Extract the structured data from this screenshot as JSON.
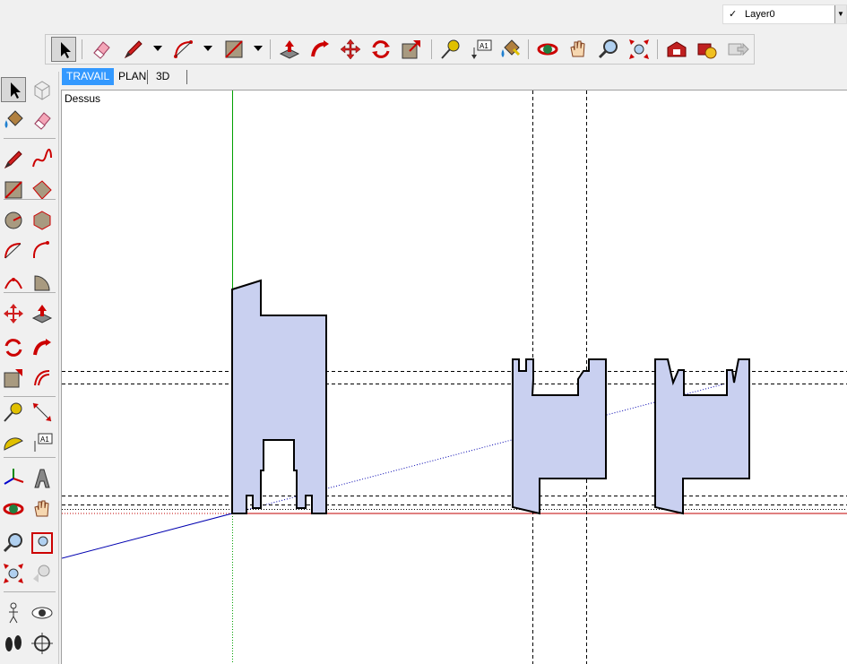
{
  "layer": {
    "check": "✓",
    "name": "Layer0"
  },
  "tabs": [
    {
      "label": "TRAVAIL",
      "active": true
    },
    {
      "label": "PLAN",
      "active": false
    },
    {
      "label": "3D",
      "active": false
    }
  ],
  "viewport": {
    "label": "Dessus"
  },
  "colors": {
    "face": "#c9d0f0",
    "axis_red": "#c00000",
    "axis_green": "#00a000",
    "axis_blue": "#0000b0",
    "tab_active": "#3399ff"
  },
  "toolbar_icons": [
    "select-icon",
    "eraser-icon",
    "pencil-icon",
    "arc-icon",
    "rectangle-icon",
    "push-pull-icon",
    "follow-me-icon",
    "move-icon",
    "rotate-icon",
    "scale-icon",
    "tape-measure-icon",
    "text-icon",
    "paint-bucket-icon",
    "orbit-icon",
    "pan-icon",
    "zoom-icon",
    "zoom-extents-icon",
    "warehouse-icon",
    "extension-icon",
    "share-icon"
  ],
  "left_icons": [
    "select-icon",
    "component-icon",
    "paint-bucket-icon",
    "eraser-icon",
    "pencil-icon",
    "freehand-icon",
    "rectangle-icon",
    "rotated-rectangle-icon",
    "circle-icon",
    "polygon-icon",
    "arc-icon",
    "two-point-arc-icon",
    "three-point-arc-icon",
    "pie-icon",
    "move-icon",
    "push-pull-icon",
    "rotate-icon",
    "follow-me-icon",
    "scale-icon",
    "offset-icon",
    "tape-measure-icon",
    "dimension-icon",
    "protractor-icon",
    "text-icon",
    "axes-icon",
    "3d-text-icon",
    "orbit-icon",
    "pan-icon",
    "zoom-icon",
    "zoom-window-icon",
    "zoom-extents-icon",
    "previous-view-icon",
    "position-camera-icon",
    "look-around-icon",
    "walk-icon",
    "section-plane-icon"
  ]
}
